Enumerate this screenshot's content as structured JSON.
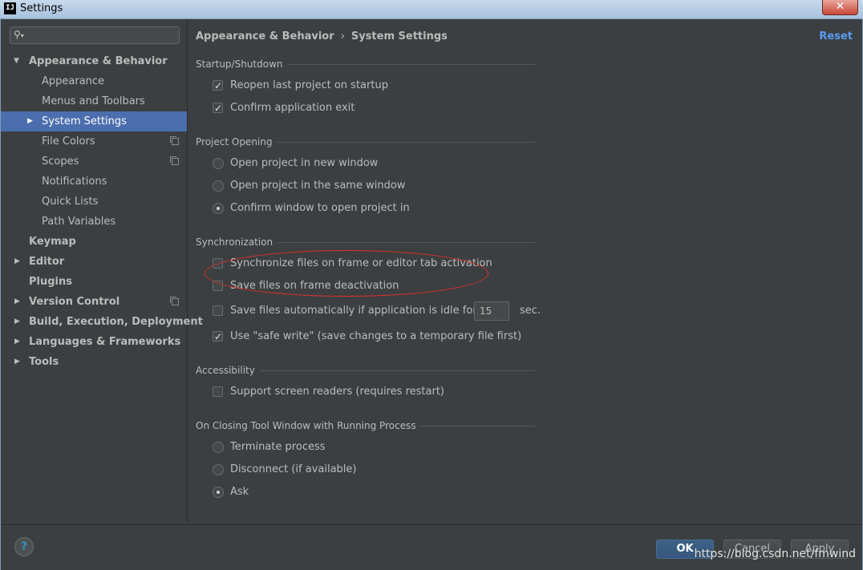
{
  "window": {
    "title": "Settings",
    "app_icon": "IJ",
    "close_glyph": "✕"
  },
  "search": {
    "placeholder": "",
    "value": ""
  },
  "sidebar": {
    "items": [
      {
        "label": "Appearance & Behavior",
        "level": 0,
        "expanded": true
      },
      {
        "label": "Appearance",
        "level": 1
      },
      {
        "label": "Menus and Toolbars",
        "level": 1
      },
      {
        "label": "System Settings",
        "level": 1,
        "selected": true
      },
      {
        "label": "File Colors",
        "level": 1
      },
      {
        "label": "Scopes",
        "level": 1
      },
      {
        "label": "Notifications",
        "level": 1
      },
      {
        "label": "Quick Lists",
        "level": 1
      },
      {
        "label": "Path Variables",
        "level": 1
      },
      {
        "label": "Keymap",
        "level": 0
      },
      {
        "label": "Editor",
        "level": 0
      },
      {
        "label": "Plugins",
        "level": 0
      },
      {
        "label": "Version Control",
        "level": 0
      },
      {
        "label": "Build, Execution, Deployment",
        "level": 0
      },
      {
        "label": "Languages & Frameworks",
        "level": 0
      },
      {
        "label": "Tools",
        "level": 0
      }
    ]
  },
  "breadcrumb": {
    "parent": "Appearance & Behavior",
    "separator": "›",
    "current": "System Settings"
  },
  "reset_label": "Reset",
  "sections": {
    "startup": {
      "title": "Startup/Shutdown",
      "reopen": {
        "label": "Reopen last project on startup",
        "checked": true
      },
      "confirm_exit": {
        "label": "Confirm application exit",
        "checked": true
      }
    },
    "project_opening": {
      "title": "Project Opening",
      "new_window": {
        "label": "Open project in new window",
        "checked": false
      },
      "same_window": {
        "label": "Open project in the same window",
        "checked": false
      },
      "confirm_window": {
        "label": "Confirm window to open project in",
        "checked": true
      }
    },
    "sync": {
      "title": "Synchronization",
      "sync_files": {
        "label": "Synchronize files on frame or editor tab activation",
        "checked": false
      },
      "save_deactivation": {
        "label": "Save files on frame deactivation",
        "checked": false
      },
      "save_idle": {
        "label": "Save files automatically if application is idle for",
        "checked": false
      },
      "idle_seconds": "15",
      "idle_unit": "sec.",
      "safe_write": {
        "label": "Use \"safe write\" (save changes to a temporary file first)",
        "checked": true
      }
    },
    "accessibility": {
      "title": "Accessibility",
      "screen_readers": {
        "label": "Support screen readers (requires restart)",
        "checked": false
      }
    },
    "closing_tool_window": {
      "title": "On Closing Tool Window with Running Process",
      "terminate": {
        "label": "Terminate process",
        "checked": false
      },
      "disconnect": {
        "label": "Disconnect (if available)",
        "checked": false
      },
      "ask": {
        "label": "Ask",
        "checked": true
      }
    }
  },
  "footer": {
    "help_glyph": "?",
    "ok_label": "OK",
    "cancel_label": "Cancel",
    "apply_label": "Apply",
    "watermark": "https://blog.csdn.net/fmwind"
  },
  "colors": {
    "background": "#3c3f41",
    "selection": "#4b6eaf",
    "link": "#589df6",
    "annotation": "#e0302a"
  }
}
